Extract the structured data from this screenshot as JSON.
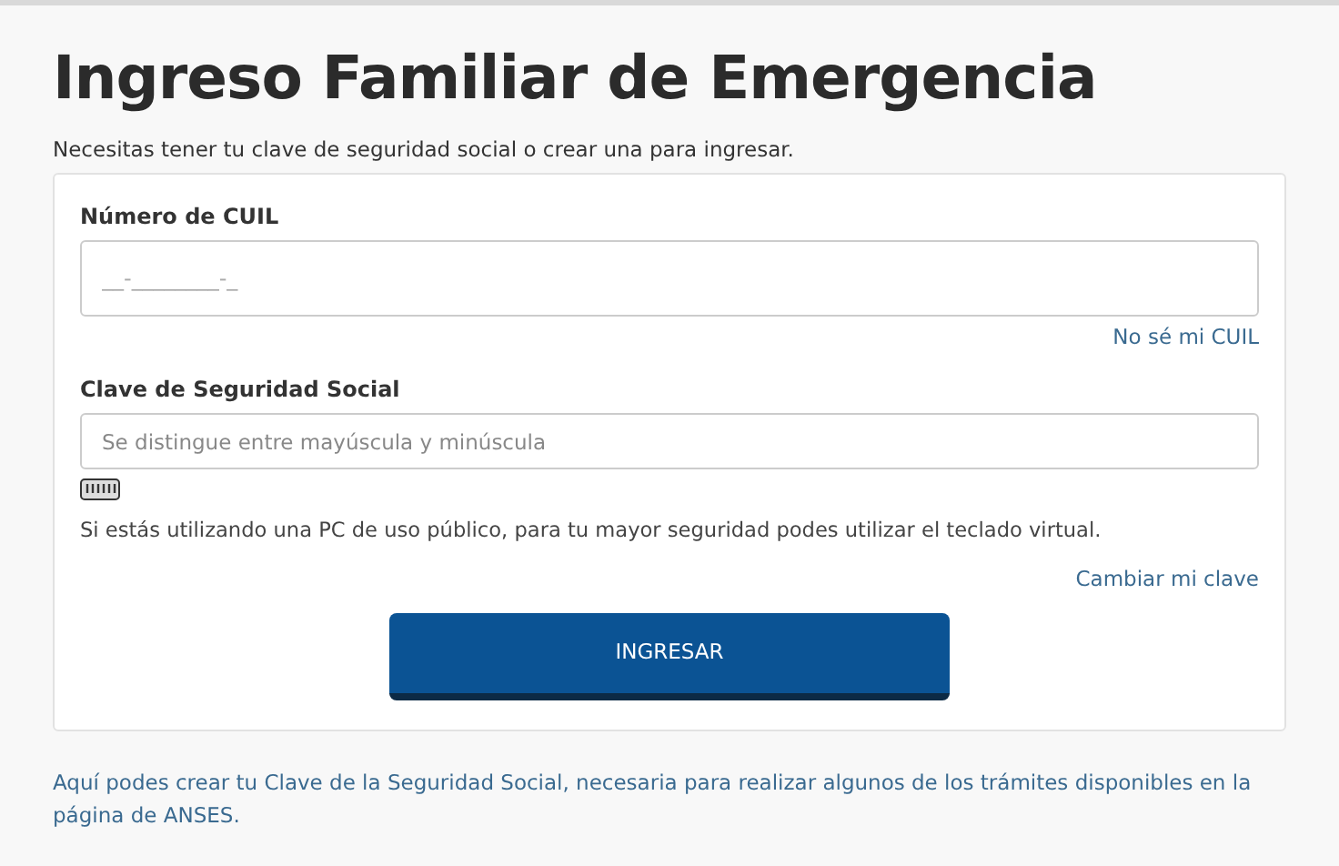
{
  "title": "Ingreso Familiar de Emergencia",
  "subtitle": "Necesitas tener tu clave de seguridad social o crear una para ingresar.",
  "cuil": {
    "label": "Número de CUIL",
    "placeholder": "__-________-_",
    "link": "No sé mi CUIL"
  },
  "password": {
    "label": "Clave de Seguridad Social",
    "placeholder": "Se distingue entre mayúscula y minúscula",
    "hint": "Si estás utilizando una PC de uso público, para tu mayor seguridad podes utilizar el teclado virtual.",
    "link": "Cambiar mi clave"
  },
  "submit": "INGRESAR",
  "footer_link": "Aquí podes crear tu Clave de la Seguridad Social, necesaria para realizar algunos de los trámites disponibles en la página de ANSES."
}
